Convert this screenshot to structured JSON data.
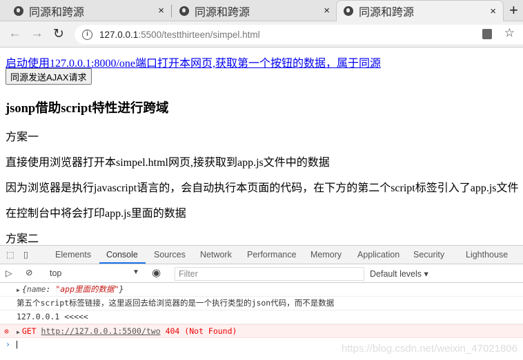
{
  "browser": {
    "tabs": [
      {
        "title": "同源和跨源",
        "active": false
      },
      {
        "title": "同源和跨源",
        "active": false
      },
      {
        "title": "同源和跨源",
        "active": true
      }
    ],
    "close_glyph": "×",
    "new_tab_glyph": "+",
    "url_host": "127.0.0.1",
    "url_rest": ":5500/testthirteen/simpel.html"
  },
  "page": {
    "link": "启动使用127.0.0.1:8000/one端口打开本网页,获取第一个按钮的数据，属于同源",
    "button": "同源发送AJAX请求",
    "heading": "jsonp借助script特性进行跨域",
    "paragraphs": [
      "方案一",
      "直接使用浏览器打开本simpel.html网页,接获取到app.js文件中的数据",
      "因为浏览器是执行javascript语言的，会自动执行本页面的代码，在下方的第二个script标签引入了app.js文件",
      "在控制台中将会打印app.js里面的数据",
      "方案二"
    ]
  },
  "devtools": {
    "tabs": [
      "Elements",
      "Console",
      "Sources",
      "Network",
      "Performance",
      "Memory",
      "Application",
      "Security",
      "Lighthouse"
    ],
    "active_tab": "Console",
    "context": "top",
    "filter_placeholder": "Filter",
    "levels": "Default levels ▾",
    "console": {
      "obj_open": "{",
      "obj_key": "name",
      "obj_value": "\"app里面的数据\"",
      "obj_close": "}",
      "log1": "第五个script标签链接，这里返回去给浏览器的是一个执行类型的json代码，而不是数据",
      "log2": "127.0.0.1 <<<<<",
      "err_method": "GET",
      "err_url": "http://127.0.0.1:5500/two",
      "err_status": "404 (Not Found)"
    },
    "watermark": "https://blog.csdn.net/weixin_47021806"
  }
}
